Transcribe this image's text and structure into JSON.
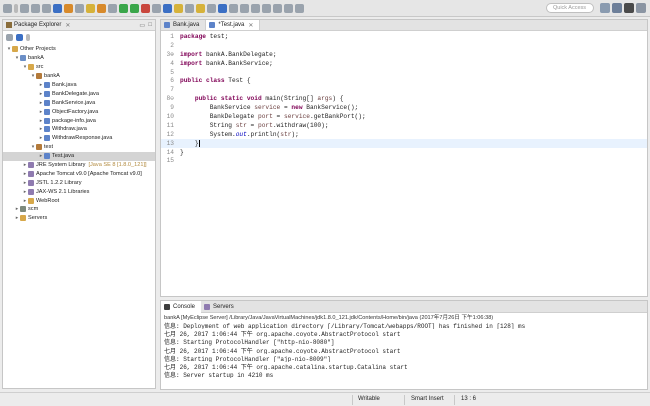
{
  "toolbar": {
    "quick_access_placeholder": "Quick Access"
  },
  "package_explorer": {
    "title": "Package Explorer",
    "tree": [
      {
        "label": "Other Projects",
        "indent": 0,
        "icon": "folder-icon",
        "arrow": "▾"
      },
      {
        "label": "bankA",
        "indent": 1,
        "icon": "project-icon",
        "arrow": "▾"
      },
      {
        "label": "src",
        "indent": 2,
        "icon": "source-folder-icon",
        "arrow": "▾"
      },
      {
        "label": "bankA",
        "indent": 3,
        "icon": "package-icon",
        "arrow": "▾"
      },
      {
        "label": "Bank.java",
        "indent": 4,
        "icon": "java-file-icon",
        "arrow": "▸"
      },
      {
        "label": "BankDelegate.java",
        "indent": 4,
        "icon": "java-file-icon",
        "arrow": "▸"
      },
      {
        "label": "BankService.java",
        "indent": 4,
        "icon": "java-file-icon",
        "arrow": "▸"
      },
      {
        "label": "ObjectFactory.java",
        "indent": 4,
        "icon": "java-file-icon",
        "arrow": "▸"
      },
      {
        "label": "package-info.java",
        "indent": 4,
        "icon": "java-file-icon",
        "arrow": "▸"
      },
      {
        "label": "Withdraw.java",
        "indent": 4,
        "icon": "java-file-icon",
        "arrow": "▸"
      },
      {
        "label": "WithdrawResponse.java",
        "indent": 4,
        "icon": "java-file-icon",
        "arrow": "▸"
      },
      {
        "label": "test",
        "indent": 3,
        "icon": "package-icon",
        "arrow": "▾"
      },
      {
        "label": "Test.java",
        "indent": 4,
        "icon": "java-file-icon",
        "arrow": "▸",
        "selected": true
      },
      {
        "label": "JRE System Library",
        "extra": "[Java SE 8 [1.8.0_121]]",
        "indent": 2,
        "icon": "library-icon",
        "arrow": "▸"
      },
      {
        "label": "Apache Tomcat v9.0 [Apache Tomcat v9.0]",
        "indent": 2,
        "icon": "library-icon",
        "arrow": "▸"
      },
      {
        "label": "JSTL 1.2.2 Library",
        "indent": 2,
        "icon": "library-icon",
        "arrow": "▸"
      },
      {
        "label": "JAX-WS 2.1 Libraries",
        "indent": 2,
        "icon": "library-icon",
        "arrow": "▸"
      },
      {
        "label": "WebRoot",
        "indent": 2,
        "icon": "folder-icon",
        "arrow": "▸"
      },
      {
        "label": "scm",
        "indent": 1,
        "icon": "scm-icon",
        "arrow": "▸"
      },
      {
        "label": "Servers",
        "indent": 1,
        "icon": "folder-icon",
        "arrow": "▸"
      }
    ]
  },
  "editor": {
    "tabs": [
      {
        "label": "Bank.java",
        "active": false
      },
      {
        "label": "*Test.java",
        "active": true
      }
    ]
  },
  "console": {
    "tabs": [
      {
        "label": "Console",
        "active": true
      },
      {
        "label": "Servers",
        "active": false
      }
    ],
    "path": "bankA [MyEclipse Server] /Library/Java/JavaVirtualMachines/jdk1.8.0_121.jdk/Contents/Home/bin/java (2017年7月26日 下午1:06:38)",
    "lines": [
      "信息: Deployment of web application directory [/Library/Tomcat/webapps/ROOT] has finished in [128] ms",
      "七月 26, 2017 1:06:44 下午 org.apache.coyote.AbstractProtocol start",
      "信息: Starting ProtocolHandler [\"http-nio-8080\"]",
      "七月 26, 2017 1:06:44 下午 org.apache.coyote.AbstractProtocol start",
      "信息: Starting ProtocolHandler [\"ajp-nio-8009\"]",
      "七月 26, 2017 1:06:44 下午 org.apache.catalina.startup.Catalina start",
      "信息: Server startup in 4210 ms"
    ]
  },
  "status_bar": {
    "writable": "Writable",
    "insert_mode": "Smart Insert",
    "position": "13 : 6"
  }
}
